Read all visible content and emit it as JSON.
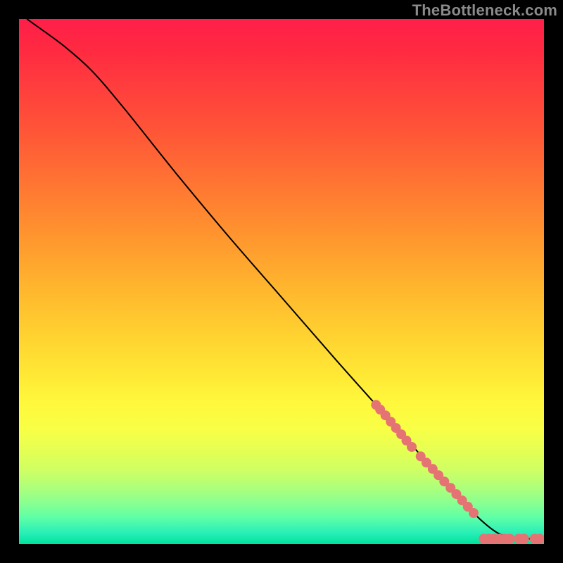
{
  "watermark": "TheBottleneck.com",
  "chart_data": {
    "type": "line",
    "title": "",
    "xlabel": "",
    "ylabel": "",
    "xlim": [
      0,
      100
    ],
    "ylim": [
      0,
      100
    ],
    "grid": false,
    "legend": false,
    "curve": [
      {
        "x": 1.5,
        "y": 100
      },
      {
        "x": 5,
        "y": 97.5
      },
      {
        "x": 9,
        "y": 94.5
      },
      {
        "x": 14,
        "y": 90
      },
      {
        "x": 20,
        "y": 83
      },
      {
        "x": 30,
        "y": 70.5
      },
      {
        "x": 40,
        "y": 58.5
      },
      {
        "x": 50,
        "y": 47
      },
      {
        "x": 60,
        "y": 35.5
      },
      {
        "x": 68,
        "y": 26.5
      },
      {
        "x": 76,
        "y": 17.5
      },
      {
        "x": 82,
        "y": 11
      },
      {
        "x": 87,
        "y": 5.5
      },
      {
        "x": 91,
        "y": 2.2
      },
      {
        "x": 94,
        "y": 1.2
      },
      {
        "x": 97,
        "y": 1
      },
      {
        "x": 100,
        "y": 1
      }
    ],
    "markers": [
      {
        "x": 68,
        "y": 26.5
      },
      {
        "x": 68.8,
        "y": 25.6
      },
      {
        "x": 69.8,
        "y": 24.5
      },
      {
        "x": 70.8,
        "y": 23.3
      },
      {
        "x": 71.8,
        "y": 22.1
      },
      {
        "x": 72.8,
        "y": 20.9
      },
      {
        "x": 73.8,
        "y": 19.7
      },
      {
        "x": 74.8,
        "y": 18.5
      },
      {
        "x": 76.5,
        "y": 16.7
      },
      {
        "x": 77.6,
        "y": 15.5
      },
      {
        "x": 78.8,
        "y": 14.3
      },
      {
        "x": 79.9,
        "y": 13.1
      },
      {
        "x": 81,
        "y": 11.9
      },
      {
        "x": 82.2,
        "y": 10.7
      },
      {
        "x": 83.3,
        "y": 9.5
      },
      {
        "x": 84.4,
        "y": 8.3
      },
      {
        "x": 85.5,
        "y": 7.1
      },
      {
        "x": 86.6,
        "y": 5.9
      },
      {
        "x": 88.5,
        "y": 1
      },
      {
        "x": 89.5,
        "y": 1
      },
      {
        "x": 90.5,
        "y": 1
      },
      {
        "x": 91.5,
        "y": 1
      },
      {
        "x": 92.5,
        "y": 1
      },
      {
        "x": 93.5,
        "y": 1
      },
      {
        "x": 95.2,
        "y": 1
      },
      {
        "x": 96.2,
        "y": 1
      },
      {
        "x": 98.2,
        "y": 1
      },
      {
        "x": 99.2,
        "y": 1
      }
    ],
    "marker_color": "#e57373",
    "line_color": "#000000"
  }
}
